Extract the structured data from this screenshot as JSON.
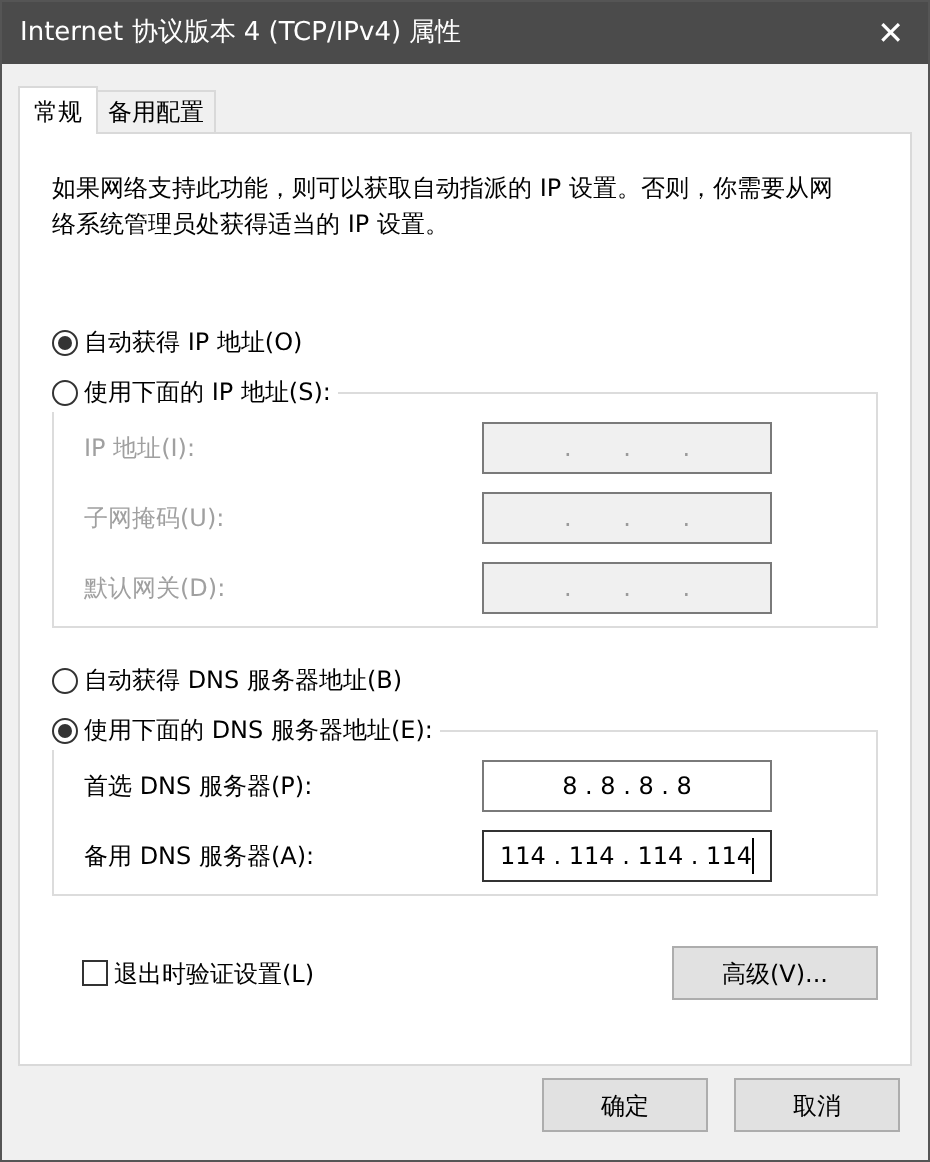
{
  "window": {
    "title": "Internet 协议版本 4 (TCP/IPv4) 属性",
    "close": "✕"
  },
  "tabs": [
    {
      "label": "常规",
      "selected": true
    },
    {
      "label": "备用配置",
      "selected": false
    }
  ],
  "description": "如果网络支持此功能，则可以获取自动指派的 IP 设置。否则，你需要从网络系统管理员处获得适当的 IP 设置。",
  "ip_options": [
    {
      "label": "自动获得 IP 地址(O)",
      "selected": true
    },
    {
      "label": "使用下面的 IP 地址(S):",
      "selected": false
    }
  ],
  "ip_group": {
    "disabled": true,
    "fields": [
      {
        "label": "IP 地址(I):",
        "value": ". . .",
        "focused": false
      },
      {
        "label": "子网掩码(U):",
        "value": ". . .",
        "focused": false
      },
      {
        "label": "默认网关(D):",
        "value": ". . .",
        "focused": false
      }
    ]
  },
  "dns_options": [
    {
      "label": "自动获得 DNS 服务器地址(B)",
      "selected": false
    },
    {
      "label": "使用下面的 DNS 服务器地址(E):",
      "selected": true
    }
  ],
  "dns_group": {
    "disabled": false,
    "fields": [
      {
        "label": "首选 DNS 服务器(P):",
        "value": "8 . 8 . 8 . 8",
        "focused": false
      },
      {
        "label": "备用 DNS 服务器(A):",
        "value": "114 . 114 . 114 . 114",
        "focused": true
      }
    ]
  },
  "validate": {
    "label": "退出时验证设置(L)",
    "checked": false
  },
  "advanced_button": "高级(V)...",
  "buttons": [
    "确定",
    "取消"
  ]
}
